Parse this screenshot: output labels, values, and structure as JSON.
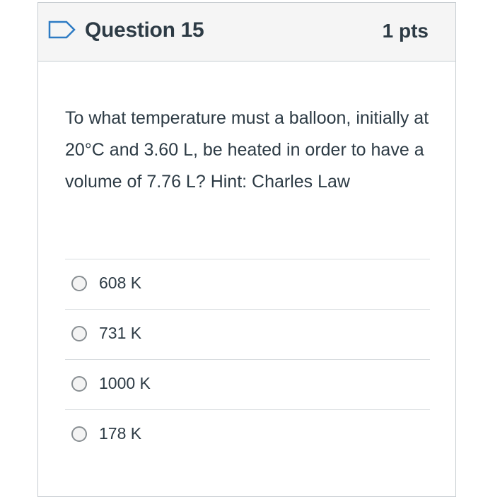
{
  "question": {
    "title": "Question 15",
    "points": "1 pts",
    "flag_icon": "bookmark-flag-icon",
    "text": "To what temperature must a balloon, initially at 20°C and 3.60 L, be heated in order to have a volume of 7.76 L? Hint: Charles Law"
  },
  "answers": [
    {
      "label": "608 K"
    },
    {
      "label": "731 K"
    },
    {
      "label": "1000 K"
    },
    {
      "label": "178 K"
    }
  ],
  "colors": {
    "text": "#2d3b45",
    "header_bg": "#f5f5f5",
    "border": "#c7cdd1",
    "flag": "#2d7bc4"
  }
}
